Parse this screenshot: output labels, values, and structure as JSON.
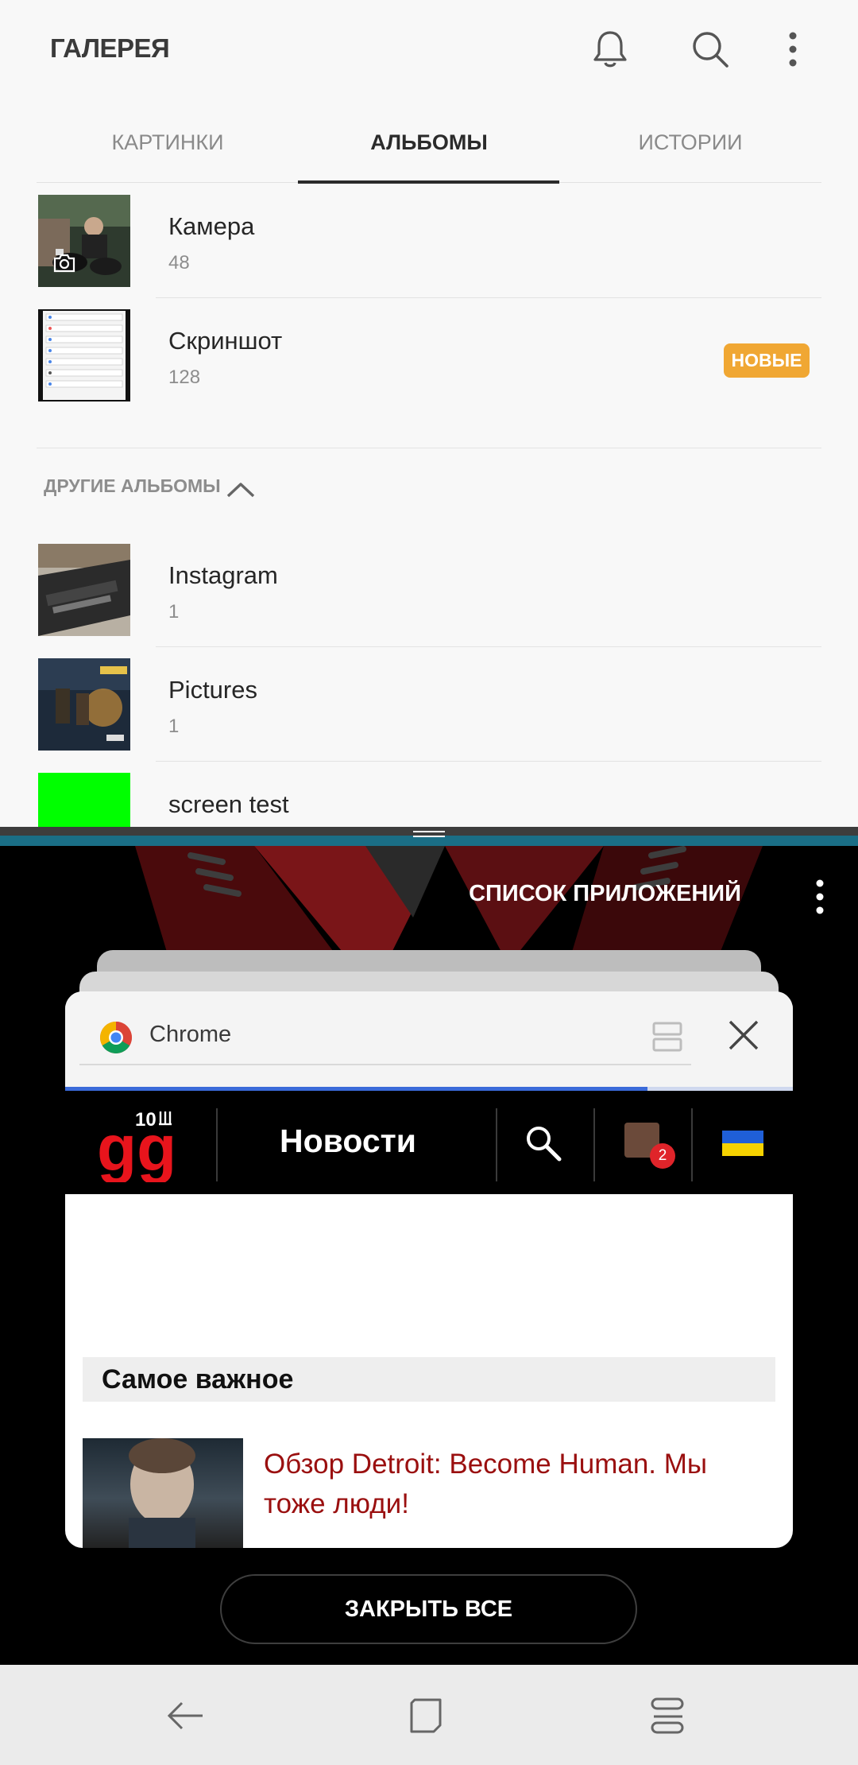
{
  "gallery": {
    "title": "ГАЛЕРЕЯ",
    "icons": {
      "notifications": "bell-icon",
      "search": "search-icon",
      "menu": "more-vertical-icon"
    },
    "tabs": [
      {
        "label": "КАРТИНКИ",
        "active": false
      },
      {
        "label": "АЛЬБОМЫ",
        "active": true
      },
      {
        "label": "ИСТОРИИ",
        "active": false
      }
    ],
    "albums": [
      {
        "name": "Камера",
        "count": "48"
      },
      {
        "name": "Скриншот",
        "count": "128",
        "badge": "НОВЫЕ"
      }
    ],
    "other_albums_label": "ДРУГИЕ АЛЬБОМЫ",
    "other_albums": [
      {
        "name": "Instagram",
        "count": "1"
      },
      {
        "name": "Pictures",
        "count": "1"
      },
      {
        "name": "screen test",
        "count": ""
      }
    ],
    "colors": {
      "badge": "#f0a733",
      "screen_test_thumb": "#00ff00"
    }
  },
  "recents": {
    "title": "СПИСОК ПРИЛОЖЕНИЙ",
    "card": {
      "app_name": "Chrome",
      "progress_fraction": 0.8,
      "site": {
        "logo_text": "gg",
        "logo_sup": "10",
        "section_title": "Новости",
        "notification_count": "2",
        "important_label": "Самое важное",
        "article_title": "Обзор Detroit: Become Human. Мы тоже люди!"
      }
    },
    "close_all": "ЗАКРЫТЬ ВСЕ"
  },
  "navbar": {
    "back": "back-icon",
    "home": "home-icon",
    "recents": "recents-icon"
  }
}
